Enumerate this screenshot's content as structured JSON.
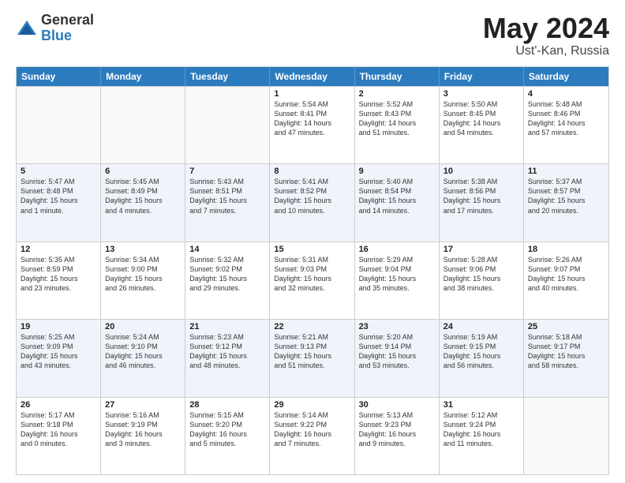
{
  "header": {
    "logo_general": "General",
    "logo_blue": "Blue",
    "title": "May 2024",
    "location": "Ust'-Kan, Russia"
  },
  "days_of_week": [
    "Sunday",
    "Monday",
    "Tuesday",
    "Wednesday",
    "Thursday",
    "Friday",
    "Saturday"
  ],
  "rows": [
    [
      {
        "day": "",
        "info": ""
      },
      {
        "day": "",
        "info": ""
      },
      {
        "day": "",
        "info": ""
      },
      {
        "day": "1",
        "info": "Sunrise: 5:54 AM\nSunset: 8:41 PM\nDaylight: 14 hours\nand 47 minutes."
      },
      {
        "day": "2",
        "info": "Sunrise: 5:52 AM\nSunset: 8:43 PM\nDaylight: 14 hours\nand 51 minutes."
      },
      {
        "day": "3",
        "info": "Sunrise: 5:50 AM\nSunset: 8:45 PM\nDaylight: 14 hours\nand 54 minutes."
      },
      {
        "day": "4",
        "info": "Sunrise: 5:48 AM\nSunset: 8:46 PM\nDaylight: 14 hours\nand 57 minutes."
      }
    ],
    [
      {
        "day": "5",
        "info": "Sunrise: 5:47 AM\nSunset: 8:48 PM\nDaylight: 15 hours\nand 1 minute."
      },
      {
        "day": "6",
        "info": "Sunrise: 5:45 AM\nSunset: 8:49 PM\nDaylight: 15 hours\nand 4 minutes."
      },
      {
        "day": "7",
        "info": "Sunrise: 5:43 AM\nSunset: 8:51 PM\nDaylight: 15 hours\nand 7 minutes."
      },
      {
        "day": "8",
        "info": "Sunrise: 5:41 AM\nSunset: 8:52 PM\nDaylight: 15 hours\nand 10 minutes."
      },
      {
        "day": "9",
        "info": "Sunrise: 5:40 AM\nSunset: 8:54 PM\nDaylight: 15 hours\nand 14 minutes."
      },
      {
        "day": "10",
        "info": "Sunrise: 5:38 AM\nSunset: 8:56 PM\nDaylight: 15 hours\nand 17 minutes."
      },
      {
        "day": "11",
        "info": "Sunrise: 5:37 AM\nSunset: 8:57 PM\nDaylight: 15 hours\nand 20 minutes."
      }
    ],
    [
      {
        "day": "12",
        "info": "Sunrise: 5:35 AM\nSunset: 8:59 PM\nDaylight: 15 hours\nand 23 minutes."
      },
      {
        "day": "13",
        "info": "Sunrise: 5:34 AM\nSunset: 9:00 PM\nDaylight: 15 hours\nand 26 minutes."
      },
      {
        "day": "14",
        "info": "Sunrise: 5:32 AM\nSunset: 9:02 PM\nDaylight: 15 hours\nand 29 minutes."
      },
      {
        "day": "15",
        "info": "Sunrise: 5:31 AM\nSunset: 9:03 PM\nDaylight: 15 hours\nand 32 minutes."
      },
      {
        "day": "16",
        "info": "Sunrise: 5:29 AM\nSunset: 9:04 PM\nDaylight: 15 hours\nand 35 minutes."
      },
      {
        "day": "17",
        "info": "Sunrise: 5:28 AM\nSunset: 9:06 PM\nDaylight: 15 hours\nand 38 minutes."
      },
      {
        "day": "18",
        "info": "Sunrise: 5:26 AM\nSunset: 9:07 PM\nDaylight: 15 hours\nand 40 minutes."
      }
    ],
    [
      {
        "day": "19",
        "info": "Sunrise: 5:25 AM\nSunset: 9:09 PM\nDaylight: 15 hours\nand 43 minutes."
      },
      {
        "day": "20",
        "info": "Sunrise: 5:24 AM\nSunset: 9:10 PM\nDaylight: 15 hours\nand 46 minutes."
      },
      {
        "day": "21",
        "info": "Sunrise: 5:23 AM\nSunset: 9:12 PM\nDaylight: 15 hours\nand 48 minutes."
      },
      {
        "day": "22",
        "info": "Sunrise: 5:21 AM\nSunset: 9:13 PM\nDaylight: 15 hours\nand 51 minutes."
      },
      {
        "day": "23",
        "info": "Sunrise: 5:20 AM\nSunset: 9:14 PM\nDaylight: 15 hours\nand 53 minutes."
      },
      {
        "day": "24",
        "info": "Sunrise: 5:19 AM\nSunset: 9:15 PM\nDaylight: 15 hours\nand 56 minutes."
      },
      {
        "day": "25",
        "info": "Sunrise: 5:18 AM\nSunset: 9:17 PM\nDaylight: 15 hours\nand 58 minutes."
      }
    ],
    [
      {
        "day": "26",
        "info": "Sunrise: 5:17 AM\nSunset: 9:18 PM\nDaylight: 16 hours\nand 0 minutes."
      },
      {
        "day": "27",
        "info": "Sunrise: 5:16 AM\nSunset: 9:19 PM\nDaylight: 16 hours\nand 3 minutes."
      },
      {
        "day": "28",
        "info": "Sunrise: 5:15 AM\nSunset: 9:20 PM\nDaylight: 16 hours\nand 5 minutes."
      },
      {
        "day": "29",
        "info": "Sunrise: 5:14 AM\nSunset: 9:22 PM\nDaylight: 16 hours\nand 7 minutes."
      },
      {
        "day": "30",
        "info": "Sunrise: 5:13 AM\nSunset: 9:23 PM\nDaylight: 16 hours\nand 9 minutes."
      },
      {
        "day": "31",
        "info": "Sunrise: 5:12 AM\nSunset: 9:24 PM\nDaylight: 16 hours\nand 11 minutes."
      },
      {
        "day": "",
        "info": ""
      }
    ]
  ]
}
